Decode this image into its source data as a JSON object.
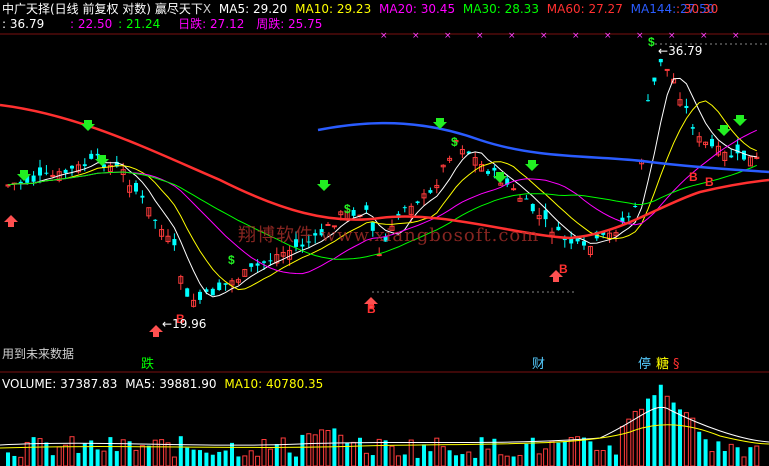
{
  "header": {
    "title": "中广天择(日线 前复权 对数)",
    "indicator": "赢尽天下",
    "close_mark": "X",
    "ma": [
      {
        "label": "MA5: 29.20",
        "color": "#ffffff"
      },
      {
        "label": "MA10: 29.23",
        "color": "#ffff00"
      },
      {
        "label": "MA20: 30.45",
        "color": "#ff00ff"
      },
      {
        "label": "MA30: 28.33",
        "color": "#00ff00"
      },
      {
        "label": "MA60: 27.27",
        "color": "#ff3030"
      },
      {
        "label": "MA144: 27.50",
        "color": "#2a5cff"
      }
    ],
    "right_value": "30.30"
  },
  "row2": {
    "left_value": "36.79",
    "v1": "22.50",
    "v2": "21.24",
    "day_drop": "日跌: 27.12",
    "week_drop": "周跌: 25.75"
  },
  "annotations": {
    "high_label": "36.79",
    "low_label": "19.96",
    "future_note": "用到未来数据",
    "watermark": "翔博软件 www.xiangbosoft.com"
  },
  "bottom_tags": [
    {
      "text": "跌",
      "color": "#00ff00",
      "bg": "#103a10"
    },
    {
      "text": "财",
      "color": "#55ccff",
      "bg": "#0a2a3a"
    },
    {
      "text": "停",
      "color": "#55ccff",
      "bg": "#0a2a3a"
    },
    {
      "text": "糖",
      "color": "#ffff00",
      "bg": "#3a3a00"
    },
    {
      "text": "§",
      "color": "#ff3030",
      "bg": "#000000"
    }
  ],
  "volume": {
    "label": "VOLUME: 37387.83",
    "ma5": "MA5: 39881.90",
    "ma10": "MA10: 40780.35"
  },
  "colors": {
    "up": "#ff3c3c",
    "down": "#00ffff",
    "ma5": "#ffffff",
    "ma10": "#ffff00",
    "ma20": "#ff00ff",
    "ma30": "#00ff00",
    "ma60": "#ff3030",
    "ma144": "#2a5cff"
  }
}
